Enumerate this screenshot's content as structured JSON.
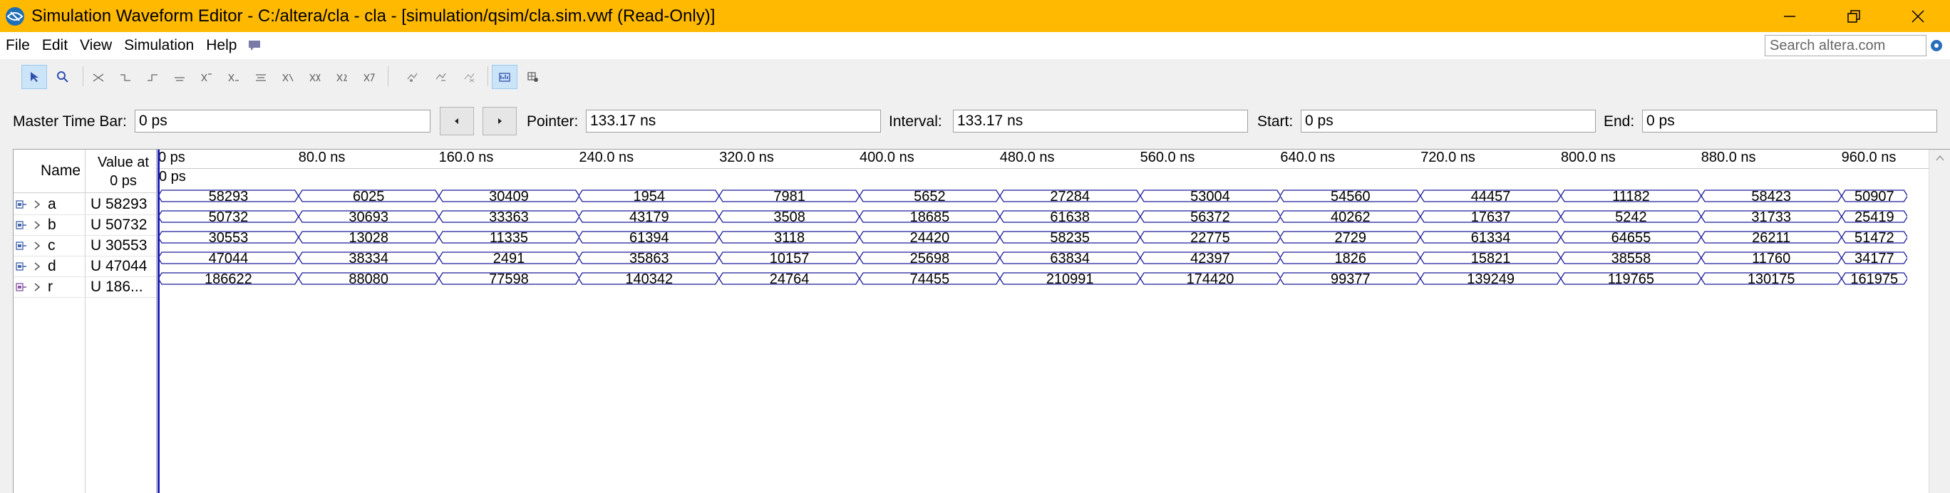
{
  "window": {
    "title": "Simulation Waveform Editor - C:/altera/cla - cla - [simulation/qsim/cla.sim.vwf (Read-Only)]",
    "accent_color": "#ffb900",
    "minimize_icon": "minimize-icon",
    "maximize_icon": "restore-icon",
    "close_icon": "close-icon"
  },
  "menu": {
    "items": [
      "File",
      "Edit",
      "View",
      "Simulation",
      "Help"
    ],
    "search_placeholder": "Search altera.com"
  },
  "toolbar": {
    "buttons": [
      "selection-tool",
      "zoom-tool",
      "forcing-unknown",
      "forcing-low",
      "forcing-high",
      "high-impedance",
      "weak-unknown",
      "weak-low",
      "weak-high",
      "invert",
      "count-value",
      "clock",
      "arbitrary-value",
      "random-value",
      "run-functional-simulation",
      "run-timing-simulation",
      "generate-netlist",
      "waveform-view",
      "grid-settings"
    ]
  },
  "timebar": {
    "master_label": "Master Time Bar:",
    "master_value": "0 ps",
    "pointer_label": "Pointer:",
    "pointer_value": "133.17 ns",
    "interval_label": "Interval:",
    "interval_value": "133.17 ns",
    "start_label": "Start:",
    "start_value": "0 ps",
    "end_label": "End:",
    "end_value": "0 ps"
  },
  "grid": {
    "name_header": "Name",
    "value_header_line1": "Value at",
    "value_header_line2": "0 ps",
    "pointer_time": "0 ps"
  },
  "ruler": [
    "0 ps",
    "80.0 ns",
    "160.0 ns",
    "240.0 ns",
    "320.0 ns",
    "400.0 ns",
    "480.0 ns",
    "560.0 ns",
    "640.0 ns",
    "720.0 ns",
    "800.0 ns",
    "880.0 ns",
    "960.0 ns"
  ],
  "signals": [
    {
      "name": "a",
      "value": "U 58293",
      "type": "input",
      "values": [
        "58293",
        "6025",
        "30409",
        "1954",
        "7981",
        "5652",
        "27284",
        "53004",
        "54560",
        "44457",
        "11182",
        "58423",
        "50907"
      ]
    },
    {
      "name": "b",
      "value": "U 50732",
      "type": "input",
      "values": [
        "50732",
        "30693",
        "33363",
        "43179",
        "3508",
        "18685",
        "61638",
        "56372",
        "40262",
        "17637",
        "5242",
        "31733",
        "25419"
      ]
    },
    {
      "name": "c",
      "value": "U 30553",
      "type": "input",
      "values": [
        "30553",
        "13028",
        "11335",
        "61394",
        "3118",
        "24420",
        "58235",
        "22775",
        "2729",
        "61334",
        "64655",
        "26211",
        "51472"
      ]
    },
    {
      "name": "d",
      "value": "U 47044",
      "type": "input",
      "values": [
        "47044",
        "38334",
        "2491",
        "35863",
        "10157",
        "25698",
        "63834",
        "42397",
        "1826",
        "15821",
        "38558",
        "11760",
        "34177"
      ]
    },
    {
      "name": "r",
      "value": "U 186...",
      "type": "output",
      "values": [
        "186622",
        "88080",
        "77598",
        "140342",
        "24764",
        "74455",
        "210991",
        "174420",
        "99377",
        "139249",
        "119765",
        "130175",
        "161975"
      ]
    }
  ],
  "colors": {
    "waveform": "#1c1c9c",
    "cursor": "#2020c0"
  }
}
